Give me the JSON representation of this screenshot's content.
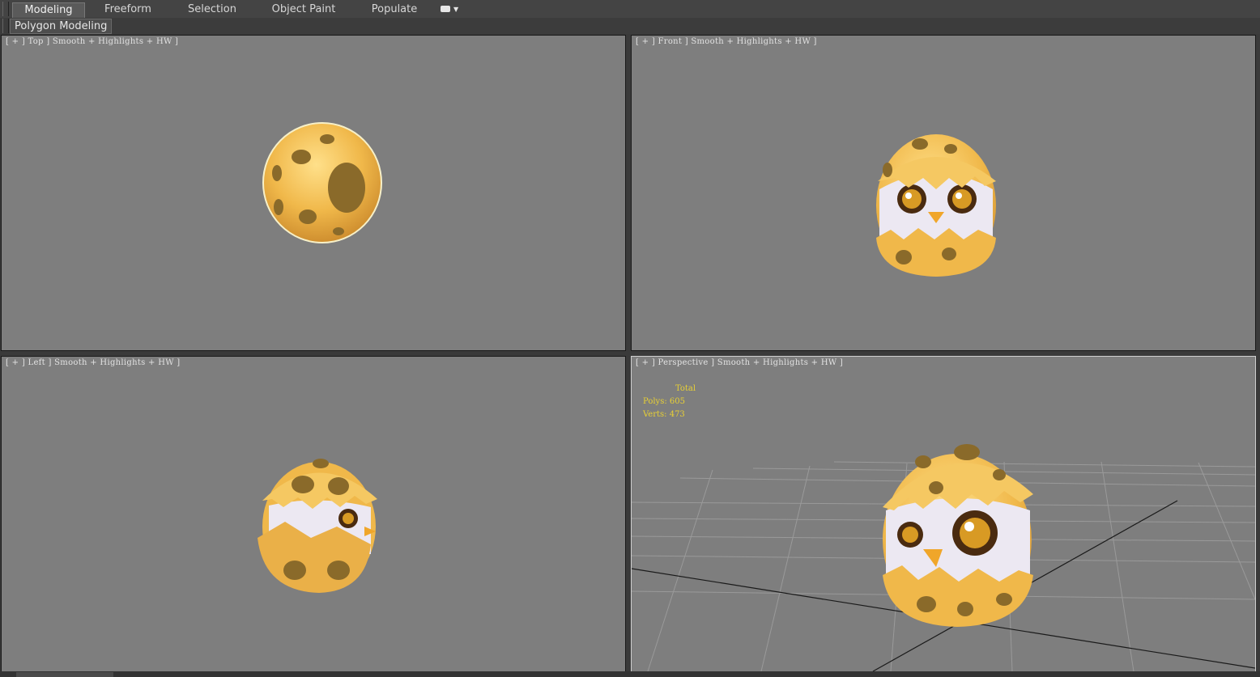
{
  "ribbon": {
    "tabs": [
      {
        "label": "Modeling",
        "active": true
      },
      {
        "label": "Freeform",
        "active": false
      },
      {
        "label": "Selection",
        "active": false
      },
      {
        "label": "Object Paint",
        "active": false
      },
      {
        "label": "Populate",
        "active": false
      }
    ],
    "panel_label": "Polygon Modeling"
  },
  "viewports": {
    "top": {
      "label": "[ + ] Top ] Smooth + Highlights + HW ]"
    },
    "front": {
      "label": "[ + ] Front ] Smooth + Highlights + HW ]"
    },
    "left": {
      "label": "[ + ] Left ] Smooth + Highlights + HW ]"
    },
    "perspective": {
      "label": "[ + ] Perspective ] Smooth + Highlights + HW ]",
      "stats": {
        "total_label": "Total",
        "polys": "Polys: 605",
        "verts": "Verts: 473"
      }
    }
  },
  "colors": {
    "viewport_bg": "#7e7e7e",
    "stats_text": "#e8d034",
    "egg_shell": "#f0b84a",
    "egg_spot": "#8a6a2a"
  }
}
